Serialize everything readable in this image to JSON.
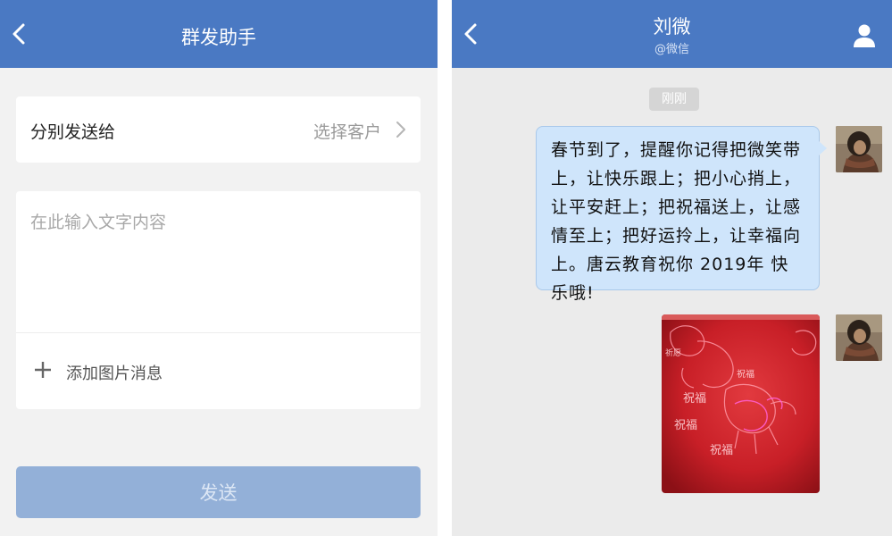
{
  "left": {
    "nav": {
      "title": "群发助手"
    },
    "recipient": {
      "label": "分别发送给",
      "value": "选择客户"
    },
    "message": {
      "placeholder": "在此输入文字内容"
    },
    "add_image": {
      "label": "添加图片消息"
    },
    "send": {
      "label": "发送"
    }
  },
  "right": {
    "nav": {
      "title": "刘微",
      "subtitle": "@微信"
    },
    "timestamp": "刚刚",
    "messages": [
      {
        "type": "text",
        "text": "春节到了，提醒你记得把微笑带上，让快乐跟上；把小心捎上，让平安赶上；把祝福送上，让感情至上；把好运拎上，让幸福向上。唐云教育祝你 2019年 快乐哦!"
      },
      {
        "type": "image",
        "image_texts": [
          "祈愿",
          "祝福",
          "祝福",
          "祝福",
          "祝福"
        ]
      }
    ]
  },
  "colors": {
    "nav": "#4a79c3",
    "bubble": "#cfe5fb",
    "send_disabled": "#93b0d8"
  }
}
